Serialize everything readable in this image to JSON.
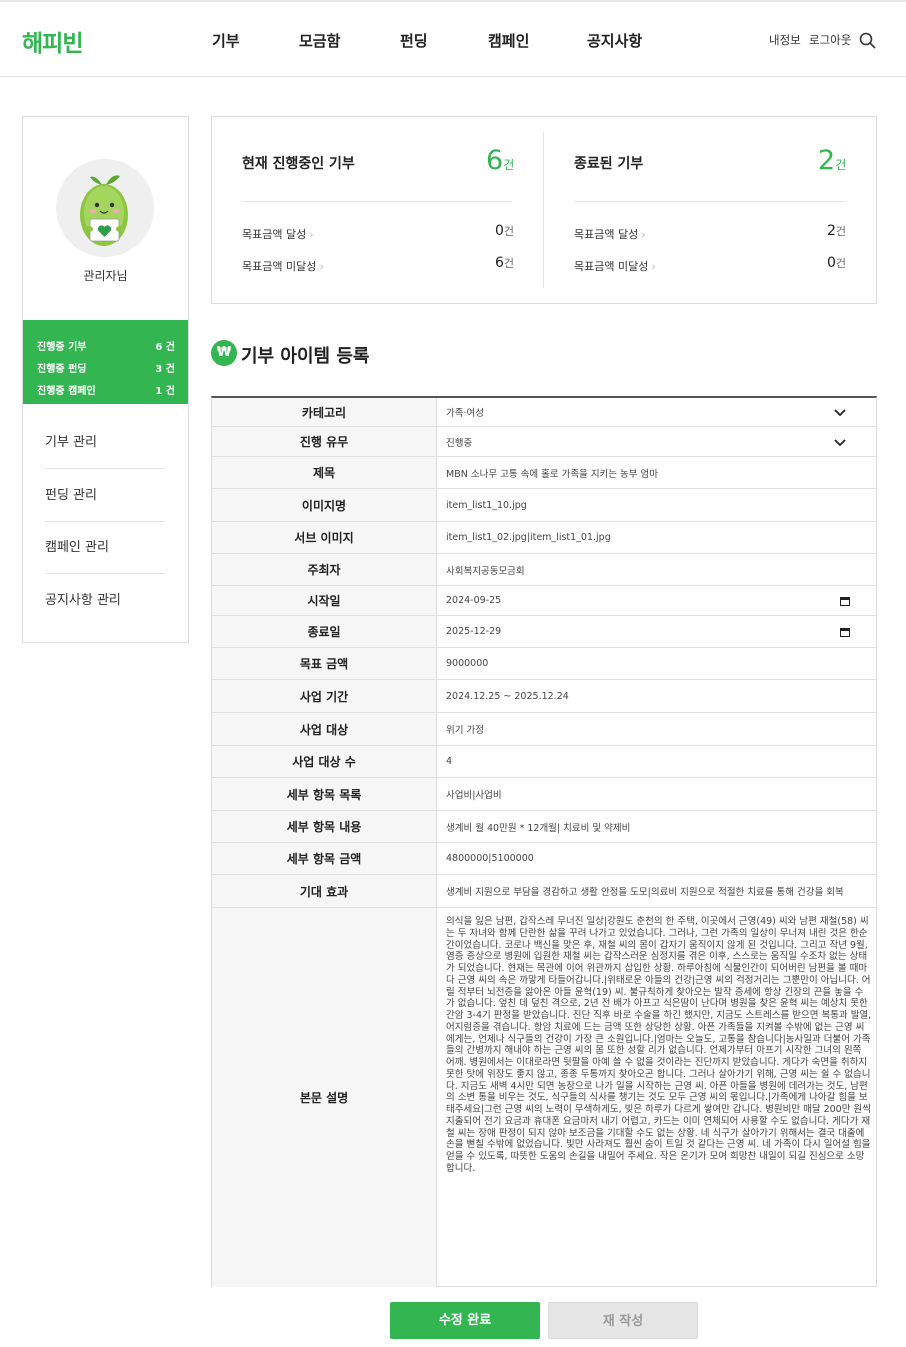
{
  "header": {
    "logo": "해피빈",
    "nav": [
      "기부",
      "모금함",
      "펀딩",
      "캠페인",
      "공지사항"
    ],
    "util": [
      "내정보",
      "로그아웃"
    ]
  },
  "sidebar": {
    "admin_name": "관리자님",
    "summary": [
      {
        "label": "진행중 기부",
        "value": "6 건"
      },
      {
        "label": "진행중 펀딩",
        "value": "3 건"
      },
      {
        "label": "진행중 캠페인",
        "value": "1 건"
      }
    ],
    "menu": [
      "기부 관리",
      "펀딩 관리",
      "캠페인 관리",
      "공지사항 관리"
    ]
  },
  "stats": {
    "ongoing": {
      "title": "현재 진행중인 기부",
      "count": "6",
      "unit": "건",
      "rows": [
        {
          "label": "목표금액 달성",
          "value": "0",
          "unit": "건"
        },
        {
          "label": "목표금액 미달성",
          "value": "6",
          "unit": "건"
        }
      ]
    },
    "ended": {
      "title": "종료된 기부",
      "count": "2",
      "unit": "건",
      "rows": [
        {
          "label": "목표금액 달성",
          "value": "2",
          "unit": "건"
        },
        {
          "label": "목표금액 미달성",
          "value": "0",
          "unit": "건"
        }
      ]
    }
  },
  "section": {
    "icon": "₩",
    "title": "기부 아이템 등록"
  },
  "form": {
    "rows": [
      {
        "label": "카테고리",
        "value": "가족·여성",
        "type": "select"
      },
      {
        "label": "진행 유무",
        "value": "진행중",
        "type": "select"
      },
      {
        "label": "제목",
        "value": "MBN 소나무 고통 속에 홀로 가족을 지키는 농부 엄마",
        "type": "text"
      },
      {
        "label": "이미지명",
        "value": "item_list1_10.jpg",
        "type": "text"
      },
      {
        "label": "서브 이미지",
        "value": "item_list1_02.jpg|item_list1_01.jpg",
        "type": "text"
      },
      {
        "label": "주최자",
        "value": "사회복지공동모금회",
        "type": "text"
      },
      {
        "label": "시작일",
        "value": "2024-09-25",
        "type": "date"
      },
      {
        "label": "종료일",
        "value": "2025-12-29",
        "type": "date"
      },
      {
        "label": "목표 금액",
        "value": "9000000",
        "type": "text"
      },
      {
        "label": "사업 기간",
        "value": "2024.12.25 ~ 2025.12.24",
        "type": "text"
      },
      {
        "label": "사업 대상",
        "value": "위기 가정",
        "type": "text"
      },
      {
        "label": "사업 대상 수",
        "value": "4",
        "type": "text"
      },
      {
        "label": "세부 항목 목록",
        "value": "사업비|사업비",
        "type": "text"
      },
      {
        "label": "세부 항목 내용",
        "value": "생계비 월 40만원 * 12개월|  치료비 및 약제비",
        "type": "text"
      },
      {
        "label": "세부 항목 금액",
        "value": "4800000|5100000",
        "type": "text"
      },
      {
        "label": "기대 효과",
        "value": "생계비 지원으로 부담을 경감하고 생활 안정을 도모|의료비 지원으로 적절한 치료를 통해 건강을 회복",
        "type": "text"
      }
    ],
    "description": {
      "label": "본문 설명",
      "value": "의식을 잃은 남편, 갑작스레 무너진 일상|강원도 춘천의 한 주택, 이곳에서 근영(49) 씨와 남편 재철(58) 씨는 두 자녀와 함께 단란한 삶을 꾸려 나가고 있었습니다. 그러나, 그런 가족의 일상이 무너져 내린 것은 한순간이었습니다. 코로나 백신을 맞은 후, 재철 씨의 몸이 갑자기 움직이지 않게 된 것입니다. 그리고 작년 9월, 염증 증상으로 병원에 입원한 재철 씨는 갑작스러운 심정지를 겪은 이후, 스스로는 움직일 수조차 없는 상태가 되었습니다. 현재는 목관에 이어 위관까지 삽입한 상황. 하루아침에 식물인간이 되어버린 남편을 볼 때마다 근영 씨의 속은 까맣게 타들어갑니다.|위태로운 아들의 건강|근영 씨의 걱정거리는 그뿐만이 아닙니다. 어릴 적부터 뇌전증을 앓아온 아들 윤혁(19) 씨. 불규칙하게 찾아오는 발작 증세에 항상 긴장의 끈을 놓을 수가 없습니다. 엎친 데 덮친 격으로, 2년 전 배가 아프고 식은땀이 난다며 병원을 찾은 윤혁 씨는 예상치 못한 간암 3-4기 판정을 받았습니다. 진단 직후 바로 수술을 하긴 했지만, 지금도 스트레스를 받으면 복통과 발열, 어지럼증을 겪습니다. 항암 치료에 드는 금액 또한 상당한 상황. 아픈 가족들을 지켜볼 수밖에 없는 근영 씨에게는, 언제나 식구들의 건강이 가장 큰 소원입니다.|엄마는 오늘도, 고통을 참습니다|농사일과 더불어 가족들의 간병까지 해내야 하는 근영 씨의 몸 또한 성할 리가 없습니다. 언제가부터 아프기 시작한 그녀의 왼쪽 어깨. 병원에서는 이대로라면 뒷팔을 아예 쓸 수 없을 것이라는 진단까지 받았습니다. 게다가 숙면을 취하지 못한 탓에 위장도 좋지 않고, 종종 두통까지 찾아오곤 합니다. 그러나 살아가기 위해, 근영 씨는 쉴 수 없습니다. 지금도 새벽 4시만 되면 농장으로 나가 일을 시작하는 근영 씨. 아픈 아들을 병원에 데려가는 것도, 남편의 소변 통을 비우는 것도, 식구들의 식사를 챙기는 것도 모두 근영 씨의 몫입니다.|가족에게 나아갈 힘을 보태주세요|그런 근영 씨의 노력이 무색하게도, 빚은 하루가 다르게 쌓여만 갑니다. 병원비만 매달 200만 원씩 지출되어 전기 요금과 휴대폰 요금마저 내기 어렵고, 카드는 이미 연체되어 사용할 수도 없습니다. 게다가 재철 씨는 장애 판정이 되지 않아 보조금을 기대할 수도 없는 상황. 네 식구가 살아가기 위해서는 결국 대출에 손을 뻗칠 수밖에 없었습니다. 빛만 사라져도 훨씬 숨이 트일 것 같다는 근영 씨. 네 가족이 다시 일어설 힘을 얻을 수 있도록, 따뜻한 도움의 손길을 내밀어 주세요. 작은 온기가 모여 희망찬 내일이 되길 진심으로 소망합니다."
    }
  },
  "buttons": {
    "submit": "수정 완료",
    "reset": "재 작성"
  },
  "colors": {
    "accent": "#33b552"
  }
}
